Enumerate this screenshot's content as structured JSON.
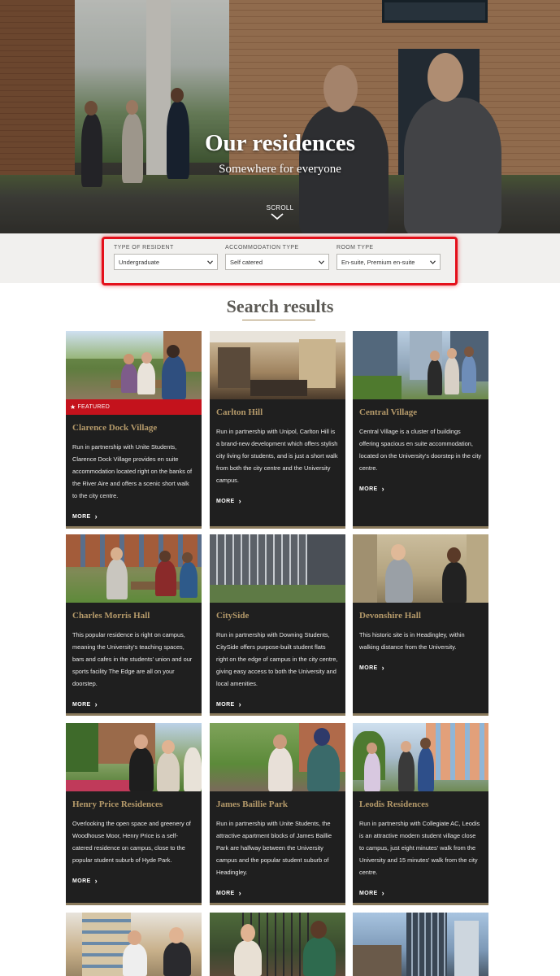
{
  "hero": {
    "title": "Our residences",
    "subtitle": "Somewhere for everyone",
    "scroll_label": "SCROLL"
  },
  "filters": {
    "resident": {
      "label": "TYPE OF RESIDENT",
      "value": "Undergraduate"
    },
    "accommodation": {
      "label": "ACCOMMODATION TYPE",
      "value": "Self catered"
    },
    "room": {
      "label": "ROOM TYPE",
      "value": "En-suite, Premium en-suite"
    }
  },
  "results": {
    "title": "Search results",
    "more_label": "MORE",
    "featured_label": "FEATURED",
    "cards": [
      {
        "name": "Clarence Dock Village",
        "desc": "Run in partnership with Unite Students, Clarence Dock Village provides en suite accommodation located right on the banks of the River Aire and offers a scenic short walk to the city centre."
      },
      {
        "name": "Carlton Hill",
        "desc": "Run in partnership with Unipol, Carlton Hill is a brand-new development which offers stylish city living for students, and is just a short walk from both the city centre and the University campus."
      },
      {
        "name": "Central Village",
        "desc": "Central Village is a cluster of buildings offering spacious en suite accommodation, located on the University's doorstep in the city centre."
      },
      {
        "name": "Charles Morris Hall",
        "desc": "This popular residence is right on campus, meaning the University's teaching spaces, bars and cafes in the students' union and our sports facility The Edge are all on your doorstep."
      },
      {
        "name": "CitySide",
        "desc": "Run in partnership with Downing Students, CitySide offers purpose-built student flats right on the edge of campus in the city centre, giving easy access to both the University and local amenities."
      },
      {
        "name": "Devonshire Hall",
        "desc": "This historic site is in Headingley, within walking distance from the University."
      },
      {
        "name": "Henry Price Residences",
        "desc": "Overlooking the open space and greenery of Woodhouse Moor, Henry Price is a self-catered residence on campus, close to the popular student suburb of Hyde Park."
      },
      {
        "name": "James Baillie Park",
        "desc": "Run in partnership with Unite Students, the attractive apartment blocks of James Baillie Park are halfway between the University campus and the popular student suburb of Headingley."
      },
      {
        "name": "Leodis Residences",
        "desc": "Run in partnership with Collegiate AC, Leodis is an attractive modern student village close to campus, just eight minutes' walk from the University and 15 minutes' walk from the city centre."
      }
    ]
  }
}
